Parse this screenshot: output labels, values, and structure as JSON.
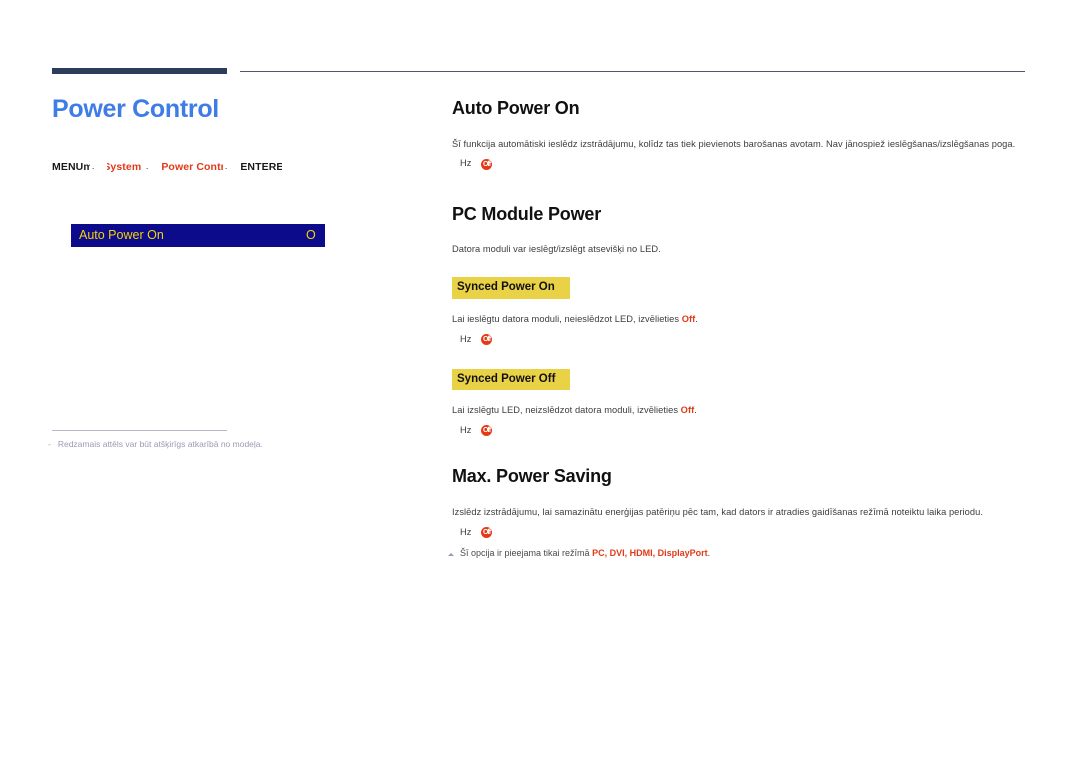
{
  "page": {
    "title": "Power Control",
    "title_color": "#3e7ce6",
    "accent_red": "#e03a18",
    "rule_color": "#2e3c5c"
  },
  "breadcrumb": {
    "menu_label": "MENU",
    "menu_key": "m",
    "arrow": "→",
    "item1": "System",
    "item2": "Power Control",
    "enter_label": "ENTER",
    "enter_key": "E"
  },
  "osd": {
    "label": "Auto Power On",
    "value": "Off",
    "bg": "#0b0b8c",
    "fg": "#f5d20a"
  },
  "left_note": {
    "dash": "-",
    "text": "Redzamais attēls var būt atšķirīgs atkarībā no modeļa."
  },
  "sections": [
    {
      "heading": "Auto Power On",
      "body": "Šī funkcija automātiski ieslēdz izstrādājumu, kolīdz tas tiek pievienots barošanas avotam. Nav jānospiež ieslēgšanas/izslēgšanas poga.",
      "hint_text": "Hz",
      "hint_icon": "off-badge"
    },
    {
      "heading": "PC Module Power",
      "body": "Datora moduli var ieslēgt/izslēgt atsevišķi no LED.",
      "subsections": [
        {
          "box_label": "Synced Power On",
          "body_pre": "Lai ieslēgtu datora moduli, neieslēdzot LED, izvēlieties ",
          "body_strong": "Off",
          "body_post": ".",
          "hint_text": "Hz",
          "hint_icon": "off-badge"
        },
        {
          "box_label": "Synced Power Off",
          "body_pre": "Lai izslēgtu LED, neizslēdzot datora moduli, izvēlieties ",
          "body_strong": "Off",
          "body_post": ".",
          "hint_text": "Hz",
          "hint_icon": "off-badge"
        }
      ]
    },
    {
      "heading": "Max. Power Saving",
      "body": "Izslēdz izstrādājumu, lai samazinātu enerģijas patēriņu pēc tam, kad dators ir atradies gaidīšanas režīmā noteiktu laika periodu.",
      "hint_text": "Hz",
      "hint_icon": "off-badge",
      "note_pre": "Šī opcija ir pieejama tikai režīmā ",
      "note_modes": "PC, DVI, HDMI, DisplayPort",
      "note_post": "."
    }
  ]
}
